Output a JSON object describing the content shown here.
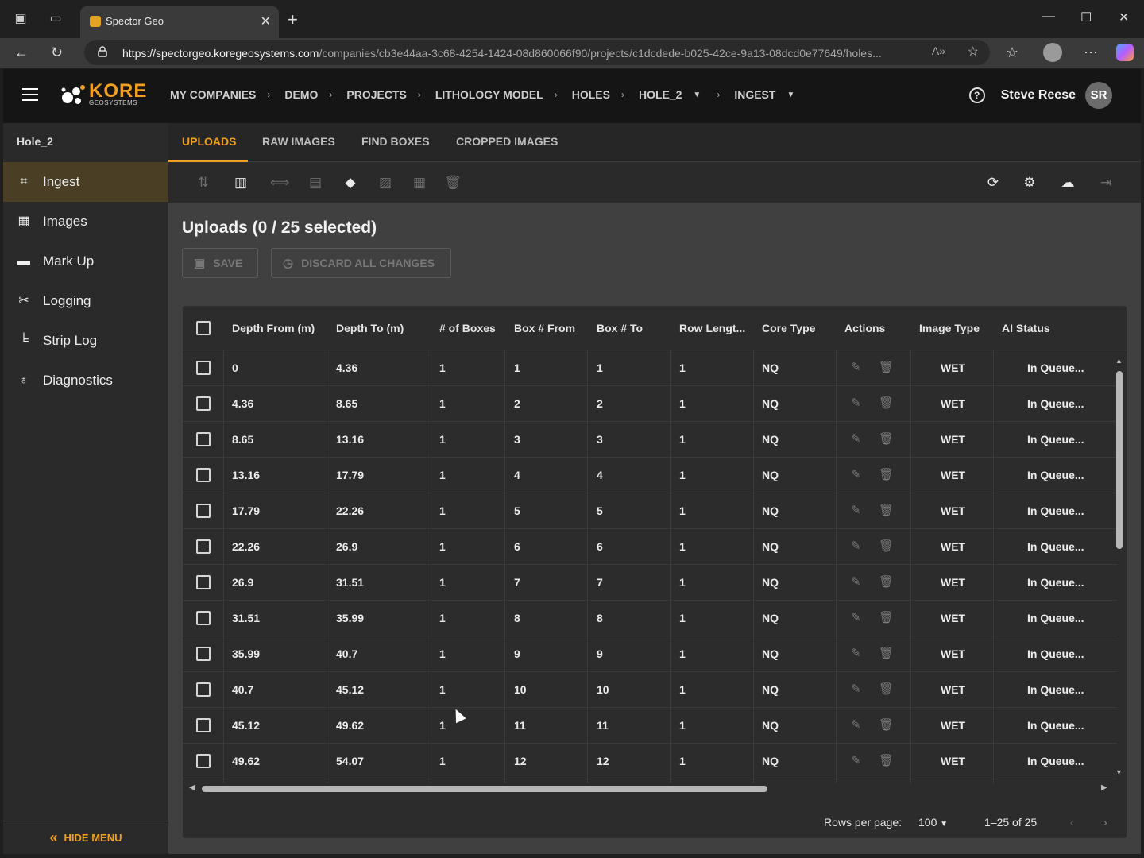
{
  "browser": {
    "tab_title": "Spector Geo",
    "url_host": "https://spectorgeo.koregeosystems.com",
    "url_path": "/companies/cb3e44aa-3c68-4254-1424-08d860066f90/projects/c1dcdede-b025-42ce-9a13-08dcd0e77649/holes..."
  },
  "header": {
    "logo_word": "KORE",
    "logo_sub": "GEOSYSTEMS",
    "breadcrumbs": [
      "MY COMPANIES",
      "DEMO",
      "PROJECTS",
      "LITHOLOGY MODEL",
      "HOLES",
      "HOLE_2",
      "INGEST"
    ],
    "user_name": "Steve Reese",
    "user_initials": "SR"
  },
  "sidebar": {
    "hole_title": "Hole_2",
    "items": [
      {
        "label": "Ingest",
        "icon": "crop-icon"
      },
      {
        "label": "Images",
        "icon": "images-icon"
      },
      {
        "label": "Mark Up",
        "icon": "ruler-icon"
      },
      {
        "label": "Logging",
        "icon": "tools-icon"
      },
      {
        "label": "Strip Log",
        "icon": "chart-icon"
      },
      {
        "label": "Diagnostics",
        "icon": "stethoscope-icon"
      }
    ],
    "hide_menu_label": "HIDE MENU"
  },
  "subtabs": [
    "UPLOADS",
    "RAW IMAGES",
    "FIND BOXES",
    "CROPPED IMAGES"
  ],
  "main": {
    "title": "Uploads (0 / 25 selected)",
    "save_label": "SAVE",
    "discard_label": "DISCARD ALL CHANGES"
  },
  "table": {
    "headers": [
      "Depth From (m)",
      "Depth To (m)",
      "# of Boxes",
      "Box # From",
      "Box # To",
      "Row Lengt...",
      "Core Type",
      "Actions",
      "Image Type",
      "AI Status"
    ],
    "rows": [
      [
        "0",
        "4.36",
        "1",
        "1",
        "1",
        "1",
        "NQ",
        "WET",
        "In Queue..."
      ],
      [
        "4.36",
        "8.65",
        "1",
        "2",
        "2",
        "1",
        "NQ",
        "WET",
        "In Queue..."
      ],
      [
        "8.65",
        "13.16",
        "1",
        "3",
        "3",
        "1",
        "NQ",
        "WET",
        "In Queue..."
      ],
      [
        "13.16",
        "17.79",
        "1",
        "4",
        "4",
        "1",
        "NQ",
        "WET",
        "In Queue..."
      ],
      [
        "17.79",
        "22.26",
        "1",
        "5",
        "5",
        "1",
        "NQ",
        "WET",
        "In Queue..."
      ],
      [
        "22.26",
        "26.9",
        "1",
        "6",
        "6",
        "1",
        "NQ",
        "WET",
        "In Queue..."
      ],
      [
        "26.9",
        "31.51",
        "1",
        "7",
        "7",
        "1",
        "NQ",
        "WET",
        "In Queue..."
      ],
      [
        "31.51",
        "35.99",
        "1",
        "8",
        "8",
        "1",
        "NQ",
        "WET",
        "In Queue..."
      ],
      [
        "35.99",
        "40.7",
        "1",
        "9",
        "9",
        "1",
        "NQ",
        "WET",
        "In Queue..."
      ],
      [
        "40.7",
        "45.12",
        "1",
        "10",
        "10",
        "1",
        "NQ",
        "WET",
        "In Queue..."
      ],
      [
        "45.12",
        "49.62",
        "1",
        "11",
        "11",
        "1",
        "NQ",
        "WET",
        "In Queue..."
      ],
      [
        "49.62",
        "54.07",
        "1",
        "12",
        "12",
        "1",
        "NQ",
        "WET",
        "In Queue..."
      ]
    ]
  },
  "pagination": {
    "rows_per_page_label": "Rows per page:",
    "rows_per_page_value": "100",
    "range": "1–25 of 25"
  },
  "colors": {
    "accent": "#f0a020",
    "active_nav_bg": "#4a3f24"
  }
}
